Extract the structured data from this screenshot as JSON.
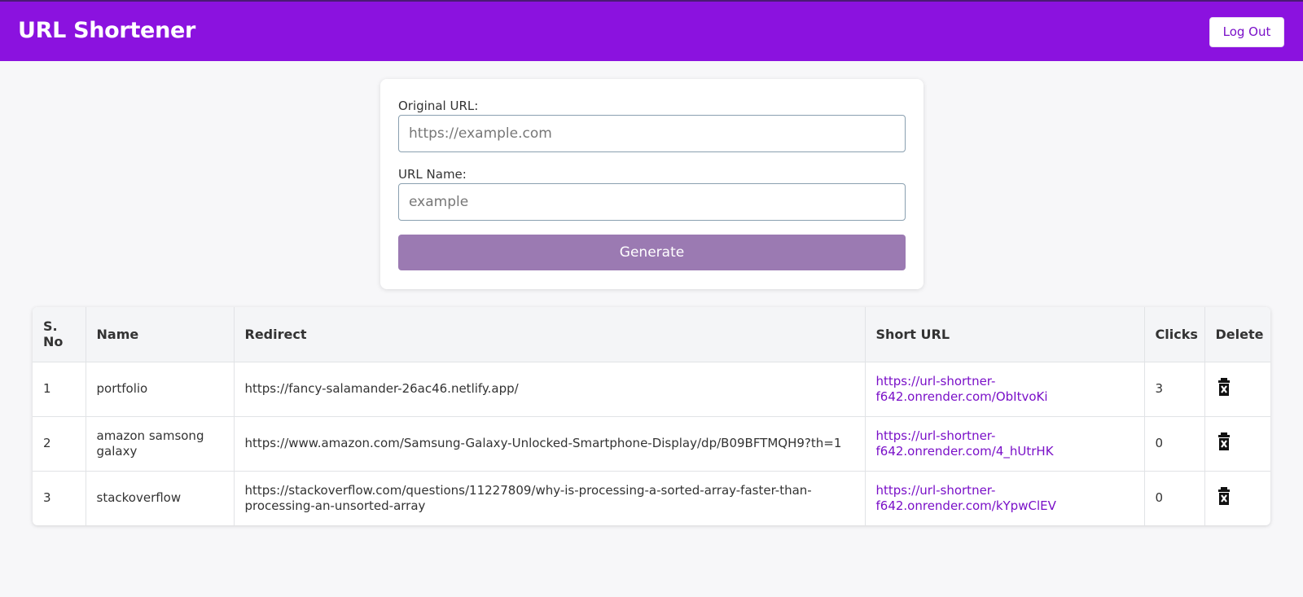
{
  "header": {
    "title": "URL Shortener",
    "logout_label": "Log Out"
  },
  "form": {
    "original_url_label": "Original URL:",
    "original_url_placeholder": "https://example.com",
    "original_url_value": "",
    "url_name_label": "URL Name:",
    "url_name_placeholder": "example",
    "url_name_value": "",
    "generate_label": "Generate"
  },
  "table": {
    "headers": [
      "S. No",
      "Name",
      "Redirect",
      "Short URL",
      "Clicks",
      "Delete"
    ],
    "rows": [
      {
        "sno": "1",
        "name": "portfolio",
        "redirect": "https://fancy-salamander-26ac46.netlify.app/",
        "short_url": "https://url-shortner-f642.onrender.com/ObItvoKi",
        "clicks": "3"
      },
      {
        "sno": "2",
        "name": "amazon samsong galaxy",
        "redirect": "https://www.amazon.com/Samsung-Galaxy-Unlocked-Smartphone-Display/dp/B09BFTMQH9?th=1",
        "short_url": "https://url-shortner-f642.onrender.com/4_hUtrHK",
        "clicks": "0"
      },
      {
        "sno": "3",
        "name": "stackoverflow",
        "redirect": "https://stackoverflow.com/questions/11227809/why-is-processing-a-sorted-array-faster-than-processing-an-unsorted-array",
        "short_url": "https://url-shortner-f642.onrender.com/kYpwClEV",
        "clicks": "0"
      }
    ],
    "delete_icon": "trash-icon"
  },
  "colors": {
    "brand": "#8b12df",
    "button": "#9b7ab2",
    "link": "#7a10c8"
  }
}
